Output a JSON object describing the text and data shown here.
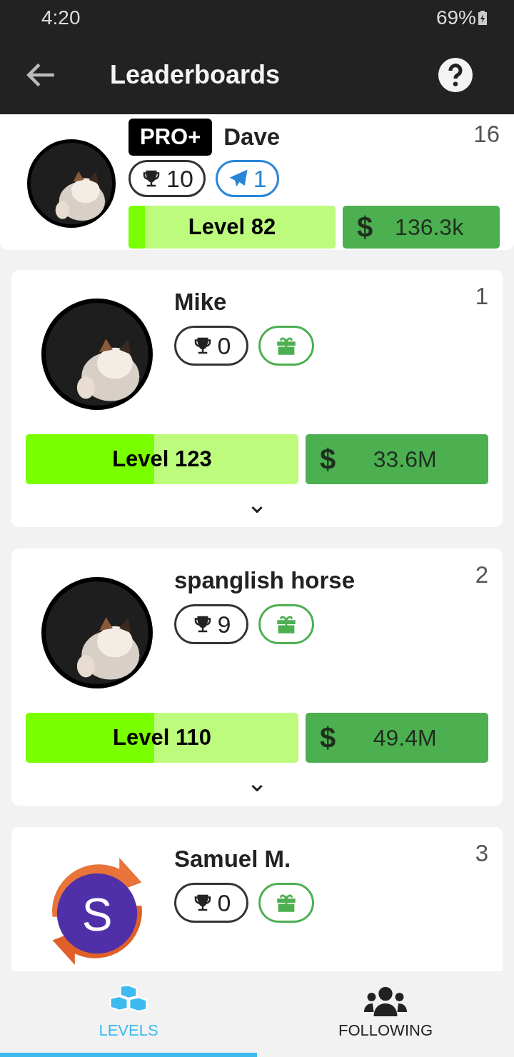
{
  "status_bar": {
    "time": "4:20",
    "battery": "69%"
  },
  "app_bar": {
    "title": "Leaderboards"
  },
  "me": {
    "badge": "PRO+",
    "name": "Dave",
    "rank": "16",
    "trophies": "10",
    "extra": {
      "kind": "plane",
      "count": "1"
    },
    "level_label": "Level 82",
    "level": 0.08,
    "currency": "$",
    "money": "136.3k"
  },
  "entries": [
    {
      "name": "Mike",
      "rank": "1",
      "trophies": "0",
      "extra": {
        "kind": "gift"
      },
      "level_label": "Level 123",
      "level": 0.47,
      "currency": "$",
      "money": "33.6M",
      "expand": "⌄"
    },
    {
      "name": "spanglish horse",
      "rank": "2",
      "trophies": "9",
      "extra": {
        "kind": "gift"
      },
      "level_label": "Level 110",
      "level": 0.47,
      "currency": "$",
      "money": "49.4M",
      "expand": "⌄"
    },
    {
      "name": "Samuel M.",
      "rank": "3",
      "trophies": "0",
      "extra": {
        "kind": "gift"
      },
      "avatar": {
        "kind": "letter",
        "letter": "S"
      }
    }
  ],
  "tabs": [
    {
      "label": "LEVELS",
      "kind": "levels",
      "selected": true
    },
    {
      "label": "FOLLOWING",
      "kind": "following",
      "selected": false
    }
  ]
}
